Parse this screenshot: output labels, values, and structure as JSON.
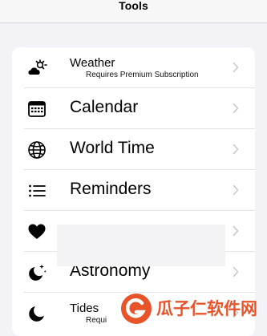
{
  "header": {
    "title": "Tools"
  },
  "rows": [
    {
      "label": "Weather",
      "subtitle": "Requires Premium Subscription",
      "icon": "weather-icon"
    },
    {
      "label": "Calendar",
      "icon": "calendar-icon"
    },
    {
      "label": "World Time",
      "icon": "globe-icon"
    },
    {
      "label": "Reminders",
      "icon": "list-icon"
    },
    {
      "label": "",
      "icon": "heart-icon"
    },
    {
      "label": "Astronomy",
      "icon": "moon-stars-icon"
    },
    {
      "label": "Tides",
      "subtitle": "Requi",
      "icon": "moon-icon"
    }
  ],
  "watermark": {
    "text": "瓜子仁软件网",
    "color": "#e8532a"
  },
  "colors": {
    "background": "#f2f2f7",
    "card": "#ffffff",
    "chevron": "#c7c7cc",
    "separator": "#e4e4e8"
  }
}
